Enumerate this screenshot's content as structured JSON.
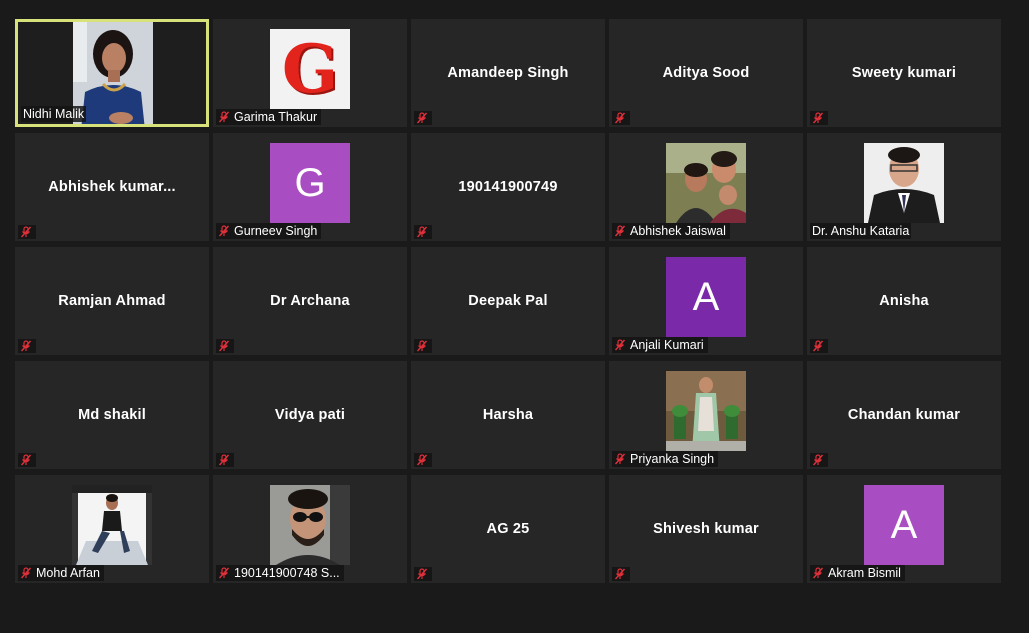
{
  "colors": {
    "background": "#1a1a1a",
    "tile": "#262626",
    "active_border": "#d8e27a",
    "mute_icon": "#e0303a"
  },
  "participants": [
    {
      "name": "Nidhi Malik",
      "display": "video",
      "active": true,
      "muted": false
    },
    {
      "name": "Garima Thakur",
      "display": "g-logo",
      "avatar_letter": "G",
      "muted": true
    },
    {
      "name": "Amandeep Singh",
      "display": "name",
      "muted": true
    },
    {
      "name": "Aditya Sood",
      "display": "name",
      "muted": true
    },
    {
      "name": "Sweety kumari",
      "display": "name",
      "muted": true
    },
    {
      "name": "Abhishek  kumar...",
      "display": "name",
      "muted": true
    },
    {
      "name": "Gurneev Singh",
      "display": "letter",
      "avatar_letter": "G",
      "avatar_color": "#a94ec2",
      "muted": true
    },
    {
      "name": "190141900749",
      "display": "name",
      "muted": true
    },
    {
      "name": "Abhishek Jaiswal",
      "display": "photo",
      "muted": true
    },
    {
      "name": "Dr. Anshu Kataria",
      "display": "photo",
      "muted": false
    },
    {
      "name": "Ramjan Ahmad",
      "display": "name",
      "muted": true
    },
    {
      "name": "Dr Archana",
      "display": "name",
      "muted": true
    },
    {
      "name": "Deepak Pal",
      "display": "name",
      "muted": true
    },
    {
      "name": "Anjali Kumari",
      "display": "letter",
      "avatar_letter": "A",
      "avatar_color": "#7a2aa8",
      "muted": true
    },
    {
      "name": "Anisha",
      "display": "name",
      "muted": true
    },
    {
      "name": "Md shakil",
      "display": "name",
      "muted": true
    },
    {
      "name": "Vidya pati",
      "display": "name",
      "muted": true
    },
    {
      "name": "Harsha",
      "display": "name",
      "muted": true
    },
    {
      "name": "Priyanka Singh",
      "display": "photo",
      "muted": true
    },
    {
      "name": "Chandan kumar",
      "display": "name",
      "muted": true
    },
    {
      "name": "Mohd Arfan",
      "display": "photo",
      "muted": true
    },
    {
      "name": "190141900748 S...",
      "display": "photo",
      "muted": true
    },
    {
      "name": "AG 25",
      "display": "name",
      "muted": true
    },
    {
      "name": "Shivesh kumar",
      "display": "name",
      "muted": true
    },
    {
      "name": "Akram Bismil",
      "display": "letter",
      "avatar_letter": "A",
      "avatar_color": "#a94ec2",
      "muted": true
    }
  ]
}
